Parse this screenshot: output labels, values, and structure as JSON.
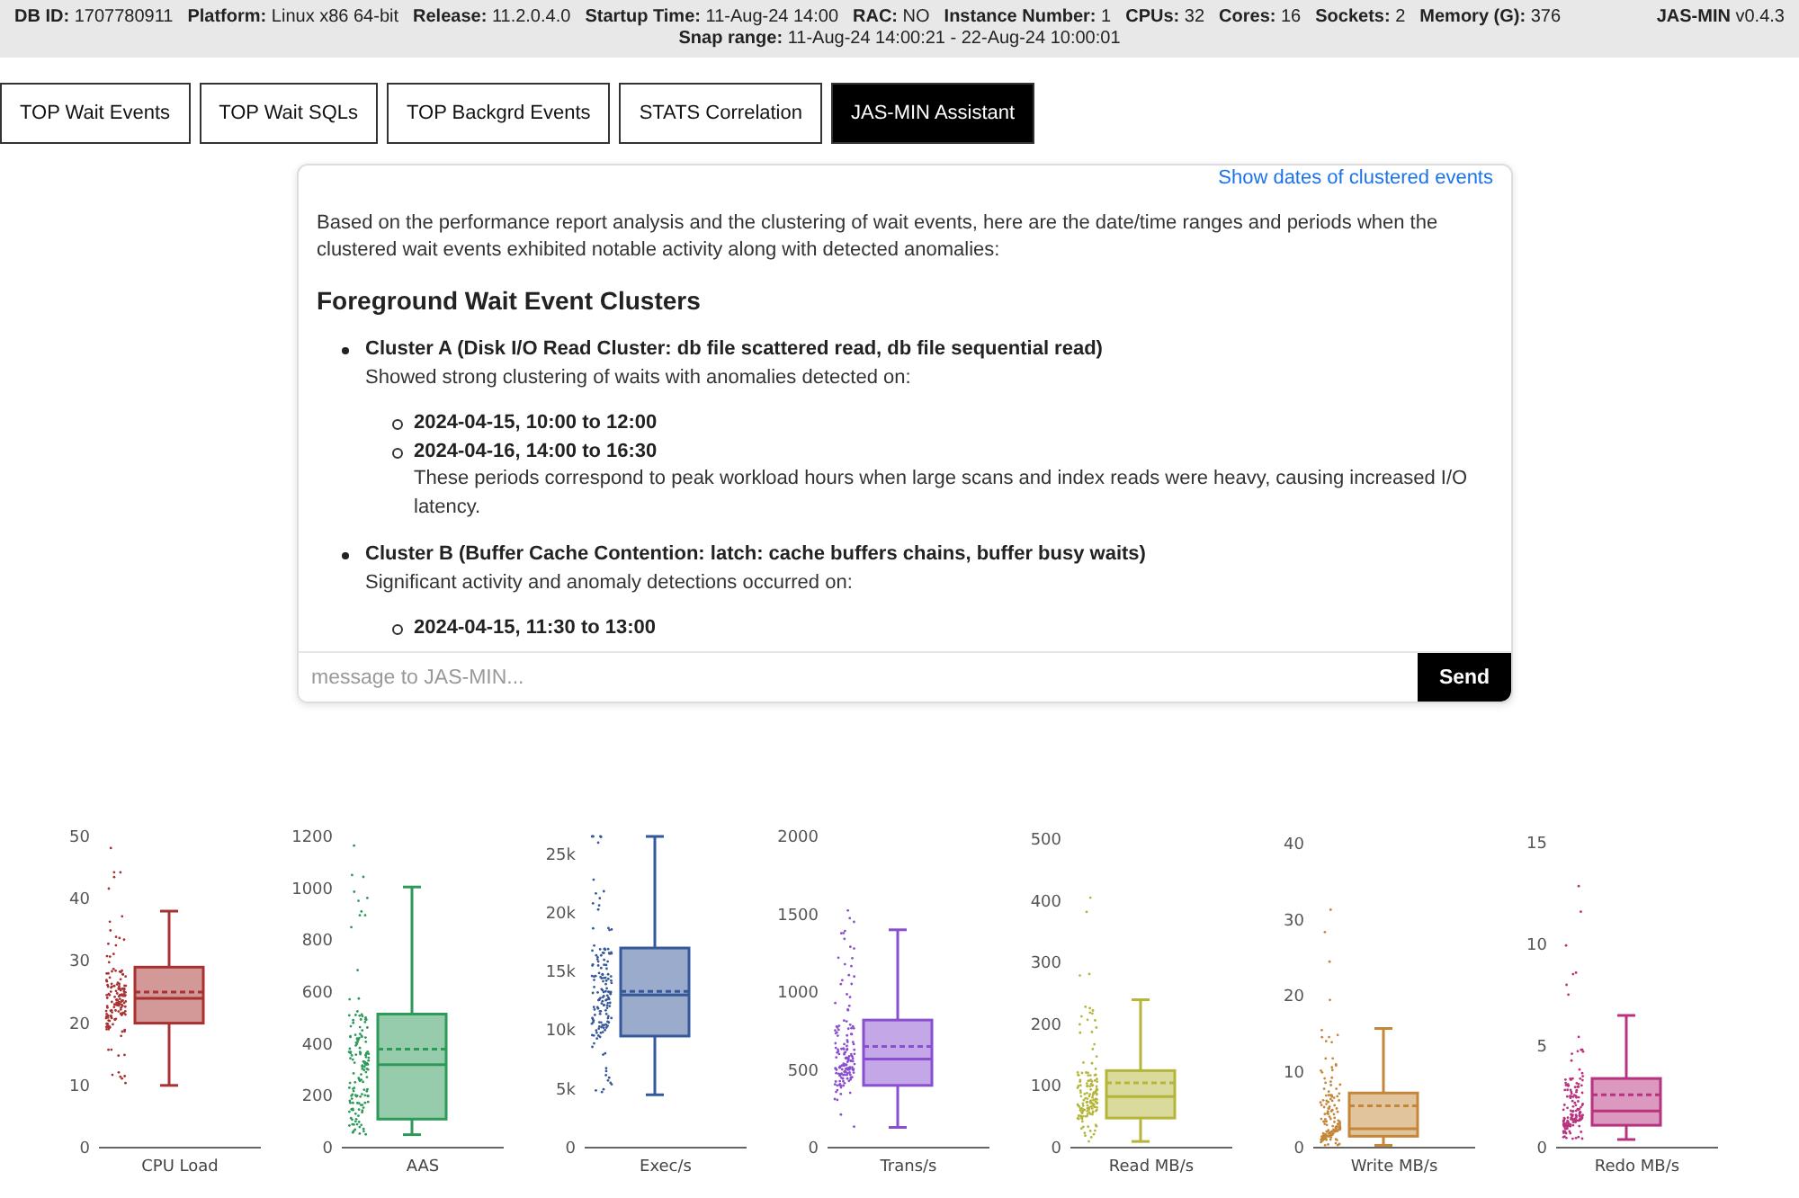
{
  "header": {
    "fields": [
      {
        "label": "DB ID:",
        "value": "1707780911"
      },
      {
        "label": "Platform:",
        "value": "Linux x86 64-bit"
      },
      {
        "label": "Release:",
        "value": "11.2.0.4.0"
      },
      {
        "label": "Startup Time:",
        "value": "11-Aug-24 14:00"
      },
      {
        "label": "RAC:",
        "value": "NO"
      },
      {
        "label": "Instance Number:",
        "value": "1"
      },
      {
        "label": "CPUs:",
        "value": "32"
      },
      {
        "label": "Cores:",
        "value": "16"
      },
      {
        "label": "Sockets:",
        "value": "2"
      },
      {
        "label": "Memory (G):",
        "value": "376"
      }
    ],
    "brand": {
      "label": "JAS-MIN",
      "value": "v0.4.3"
    },
    "snap_range": {
      "label": "Snap range:",
      "value": "11-Aug-24 14:00:21 - 22-Aug-24 10:00:01"
    }
  },
  "tabs": [
    {
      "label": "TOP Wait Events",
      "selected": false
    },
    {
      "label": "TOP Wait SQLs",
      "selected": false
    },
    {
      "label": "TOP Backgrd Events",
      "selected": false
    },
    {
      "label": "STATS Correlation",
      "selected": false
    },
    {
      "label": "JAS-MIN Assistant",
      "selected": true
    }
  ],
  "assistant": {
    "link": "Show dates of clustered events",
    "intro": "Based on the performance report analysis and the clustering of wait events, here are the date/time ranges and periods when the clustered wait events exhibited notable activity along with detected anomalies:",
    "heading": "Foreground Wait Event Clusters",
    "clusters": [
      {
        "title": "Cluster A (Disk I/O Read Cluster: db file scattered read, db file sequential read)",
        "description": "Showed strong clustering of waits with anomalies detected on:",
        "dates": [
          "2024-04-15, 10:00 to 12:00",
          "2024-04-16, 14:00 to 16:30"
        ],
        "note": "These periods correspond to peak workload hours when large scans and index reads were heavy, causing increased I/O latency."
      },
      {
        "title": "Cluster B (Buffer Cache Contention: latch: cache buffers chains, buffer busy waits)",
        "description": "Significant activity and anomaly detections occurred on:",
        "dates": [
          "2024-04-15, 11:30 to 13:00"
        ]
      }
    ],
    "input": {
      "placeholder": "message to JAS-MIN..."
    },
    "send": "Send"
  },
  "charts": [
    {
      "label": "CPU Load",
      "color": "#a83232",
      "yticks": [
        "50",
        "40",
        "30",
        "20",
        "10",
        "0"
      ]
    },
    {
      "label": "AAS",
      "color": "#2e9a5a",
      "yticks": [
        "1200",
        "1000",
        "800",
        "600",
        "400",
        "200",
        "0"
      ]
    },
    {
      "label": "Exec/s",
      "color": "#35589a",
      "yticks": [
        "25k",
        "20k",
        "15k",
        "10k",
        "5k",
        "0"
      ]
    },
    {
      "label": "Trans/s",
      "color": "#8a4fd0",
      "yticks": [
        "2000",
        "1500",
        "1000",
        "500",
        "0"
      ]
    },
    {
      "label": "Read MB/s",
      "color": "#b5b53a",
      "yticks": [
        "500",
        "400",
        "300",
        "200",
        "100",
        "0"
      ]
    },
    {
      "label": "Write MB/s",
      "color": "#c4873a",
      "yticks": [
        "40",
        "30",
        "20",
        "10",
        "0"
      ]
    },
    {
      "label": "Redo MB/s",
      "color": "#b8337f",
      "yticks": [
        "15",
        "10",
        "5",
        "0"
      ]
    }
  ]
}
